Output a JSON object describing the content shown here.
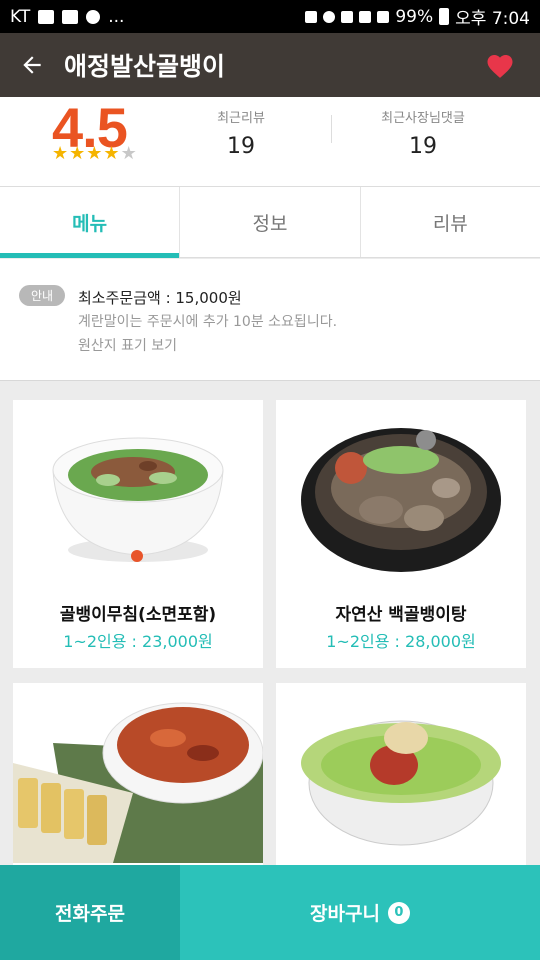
{
  "status_bar": {
    "carrier": "KT",
    "more": "...",
    "battery": "99%",
    "time": "오후 7:04"
  },
  "app_bar": {
    "title": "애정발산골뱅이"
  },
  "rating": {
    "score": "4.5",
    "stars": 4.5,
    "recent_reviews_label": "최근리뷰",
    "recent_reviews_value": "19",
    "owner_replies_label": "최근사장님댓글",
    "owner_replies_value": "19"
  },
  "tabs": [
    {
      "label": "메뉴",
      "active": true
    },
    {
      "label": "정보",
      "active": false
    },
    {
      "label": "리뷰",
      "active": false
    }
  ],
  "notice": {
    "badge": "안내",
    "min_order": "최소주문금액 : 15,000원",
    "note": "계란말이는 주문시에 추가 10분 소요됩니다.",
    "origin_link": "원산지 표기 보기"
  },
  "menu_items": [
    {
      "name": "골뱅이무침(소면포함)",
      "price": "1~2인용 : 23,000원"
    },
    {
      "name": "자연산 백골뱅이탕",
      "price": "1~2인용 : 28,000원"
    },
    {
      "name": "",
      "price": ""
    },
    {
      "name": "",
      "price": ""
    }
  ],
  "bottom_bar": {
    "call_label": "전화주문",
    "cart_label": "장바구니",
    "cart_count": "0"
  },
  "colors": {
    "accent": "#24bdb6",
    "appbar": "#403a36",
    "score": "#ea5422",
    "heart": "#e8364a"
  }
}
